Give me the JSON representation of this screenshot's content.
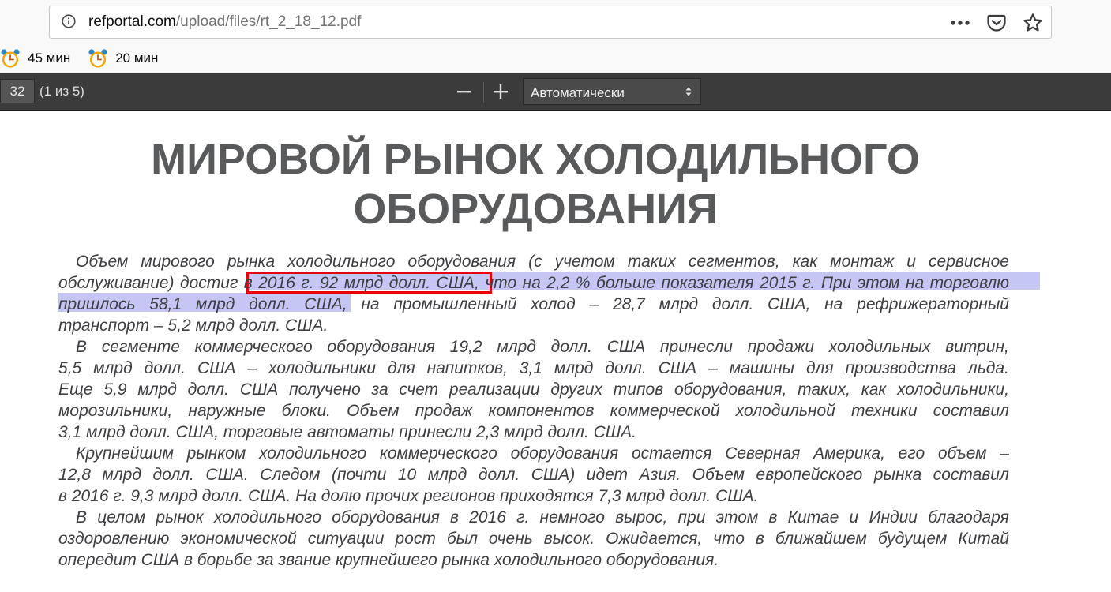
{
  "browser": {
    "url_host": "refportal.com",
    "url_path": "/upload/files/rt_2_18_12.pdf",
    "bookmarks": [
      {
        "label": "45 мин",
        "icon": "alarm-clock-icon"
      },
      {
        "label": "20 мин",
        "icon": "alarm-clock-icon"
      }
    ]
  },
  "pdf_toolbar": {
    "page_number": "32",
    "page_of": "(1 из 5)",
    "zoom_value": "Автоматически"
  },
  "doc": {
    "title_line1": "МИРОВОЙ РЫНОК ХОЛОДИЛЬНОГО",
    "title_line2": "ОБОРУДОВАНИЯ",
    "lines": [
      "Объем мирового рынка холодильного оборудования (с учетом таких сегментов, как монтаж и сервисное",
      "обслуживание) достиг в 2016 г. 92 млрд долл. США, что на 2,2 % больше показателя 2015 г. При этом на торговлю",
      "пришлось 58,1 млрд долл. США, на промышленный холод – 28,7 млрд долл. США, на рефрижераторный",
      "транспорт – 5,2 млрд долл. США.",
      "В сегменте коммерческого оборудования 19,2 млрд долл. США принесли продажи холодильных витрин,",
      "5,5 млрд долл. США – холодильники для напитков, 3,1 млрд долл. США – машины для производства льда.",
      "Еще 5,9 млрд долл. США получено за счет реализации других типов оборудования, таких, как холодильники,",
      "морозильники, наружные блоки. Объем продаж компонентов коммерческой холодильной техники составил",
      "3,1 млрд долл. США, торговые автоматы принесли 2,3 млрд долл. США.",
      "Крупнейшим рынком холодильного коммерческого оборудования остается Северная Америка, его объем –",
      "12,8 млрд долл. США. Следом (почти 10 млрд долл. США) идет Азия. Объем европейского рынка составил",
      "в 2016 г. 9,3 млрд долл. США. На долю прочих регионов приходятся 7,3 млрд долл. США.",
      "В целом рынок холодильного оборудования в 2016 г. немного вырос, при этом в Китае и Индии благодаря",
      "оздоровлению экономической ситуации рост был очень высок. Ожидается, что в ближайшем будущем Китай",
      "опередит США в борьбе за звание крупнейшего рынка холодильного оборудования."
    ]
  }
}
